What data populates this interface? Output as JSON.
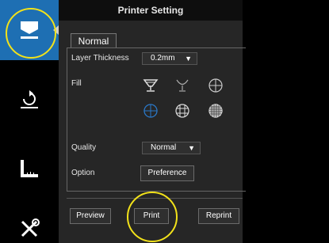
{
  "window": {
    "title": "Printer Setting"
  },
  "tab": {
    "label": "Normal"
  },
  "layer_thickness": {
    "label": "Layer Thickness",
    "value": "0.2mm",
    "arrow": "▼"
  },
  "fill": {
    "label": "Fill",
    "options": [
      "goblet-wireframe-icon",
      "goblet-hollow-icon",
      "circle-cross-icon",
      "circle-crosshair-selected-icon",
      "circle-grid-icon",
      "circle-dense-grid-icon"
    ]
  },
  "quality": {
    "label": "Quality",
    "value": "Normal",
    "arrow": "▼"
  },
  "option": {
    "label": "Option",
    "button": "Preference"
  },
  "buttons": {
    "preview": "Preview",
    "print": "Print",
    "reprint": "Reprint"
  },
  "colors": {
    "accent": "#1e6fb3",
    "highlight": "#f2e21a",
    "panel": "#262626"
  }
}
